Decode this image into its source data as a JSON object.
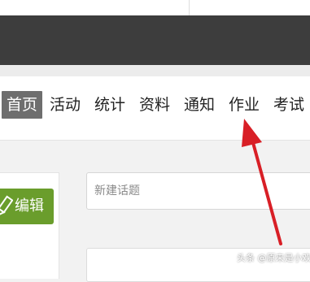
{
  "colors": {
    "header_dark": "#3d3d3d",
    "active_tab": "#6e6e6e",
    "edit_button": "#6a9d2c",
    "annotation_arrow": "#d81f26"
  },
  "nav": {
    "tabs": [
      {
        "label": "首页",
        "active": true
      },
      {
        "label": "活动",
        "active": false
      },
      {
        "label": "统计",
        "active": false
      },
      {
        "label": "资料",
        "active": false
      },
      {
        "label": "通知",
        "active": false
      },
      {
        "label": "作业",
        "active": false
      },
      {
        "label": "考试",
        "active": false
      }
    ]
  },
  "sidebar": {
    "edit_button": {
      "label": "编辑",
      "icon": "pencil-icon"
    }
  },
  "topic": {
    "placeholder": "新建话题"
  },
  "annotation": {
    "icon": "red-arrow-icon"
  },
  "watermark": {
    "text": "头条 @原来是小欢"
  }
}
